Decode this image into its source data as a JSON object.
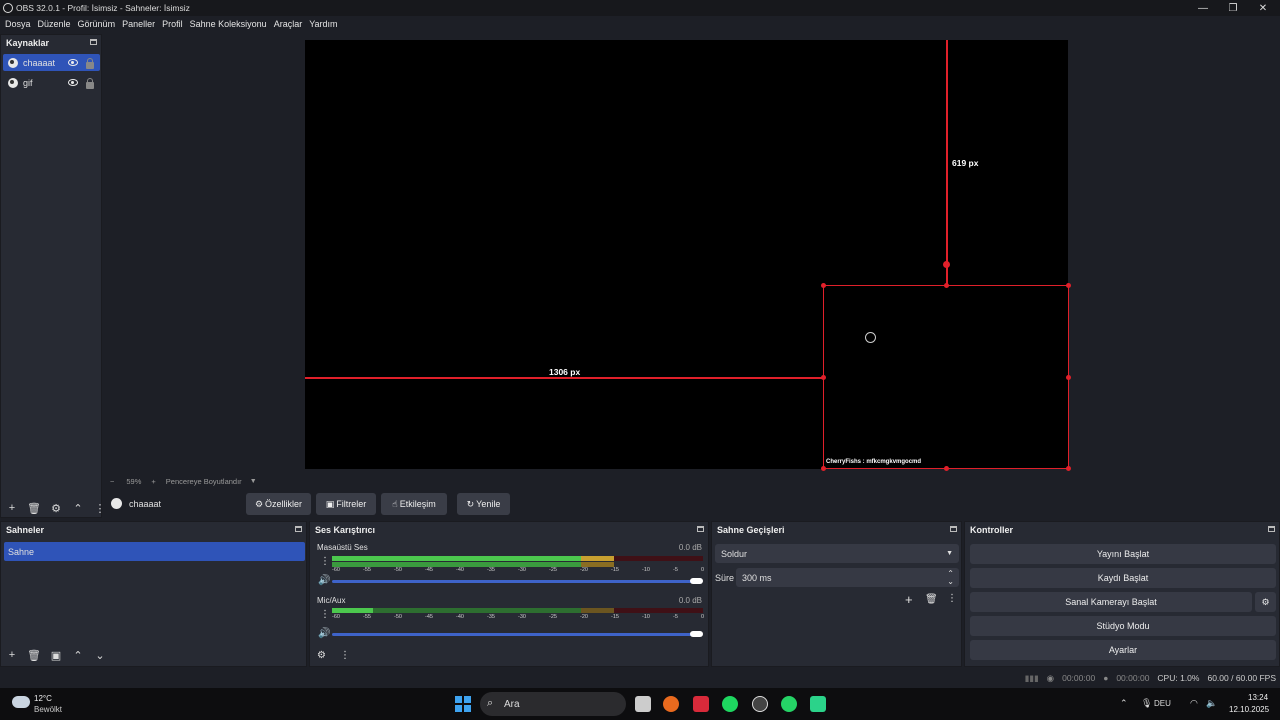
{
  "titlebar": {
    "title": "OBS 32.0.1 - Profil: İsimsiz - Sahneler: İsimsiz",
    "minimize": "—",
    "maximize": "❐",
    "close": "✕"
  },
  "menu": [
    "Dosya",
    "Düzenle",
    "Görünüm",
    "Paneller",
    "Profil",
    "Sahne Koleksiyonu",
    "Araçlar",
    "Yardım"
  ],
  "sources": {
    "title": "Kaynaklar",
    "items": [
      {
        "label": "chaaaat",
        "selected": true
      },
      {
        "label": "gif",
        "selected": false
      }
    ]
  },
  "preview": {
    "measure_horizontal": "1306 px",
    "measure_vertical": "619 px",
    "overlay_text": "CherryFishs : mfkcmgkvmgocmd"
  },
  "zoom": {
    "minus": "−",
    "level": "59%",
    "plus": "+",
    "mode": "Pencereye Boyutlandır"
  },
  "context": {
    "source_name": "chaaaat",
    "buttons": [
      "Özellikler",
      "Filtreler",
      "Etkileşim",
      "Yenile"
    ]
  },
  "scenes": {
    "title": "Sahneler",
    "items": [
      "Sahne"
    ]
  },
  "mixer": {
    "title": "Ses Karıştırıcı",
    "channels": [
      {
        "name": "Masaüstü Ses",
        "db": "0.0 dB",
        "level": 0.72
      },
      {
        "name": "Mic/Aux",
        "db": "0.0 dB",
        "level": 0.11
      }
    ],
    "ticks": [
      "-60",
      "-55",
      "-50",
      "-45",
      "-40",
      "-35",
      "-30",
      "-25",
      "-20",
      "-15",
      "-10",
      "-5",
      "0"
    ]
  },
  "transitions": {
    "title": "Sahne Geçişleri",
    "selected": "Soldur",
    "duration_label": "Süre",
    "duration": "300 ms"
  },
  "controls": {
    "title": "Kontroller",
    "buttons": [
      "Yayını Başlat",
      "Kaydı Başlat",
      "Sanal Kamerayı Başlat",
      "Stüdyo Modu",
      "Ayarlar"
    ]
  },
  "status": {
    "stream_time": "00:00:00",
    "record_time": "00:00:00",
    "cpu": "CPU: 1.0%",
    "fps": "60.00 / 60.00 FPS"
  },
  "taskbar": {
    "temp": "12°C",
    "weather": "Bewölkt",
    "search": "Ara",
    "lang": "DEU",
    "time": "13:24",
    "date": "12.10.2025"
  },
  "colors": {
    "accent": "#2f54b8",
    "selection_red": "#e0202a",
    "panel": "#272a33"
  }
}
